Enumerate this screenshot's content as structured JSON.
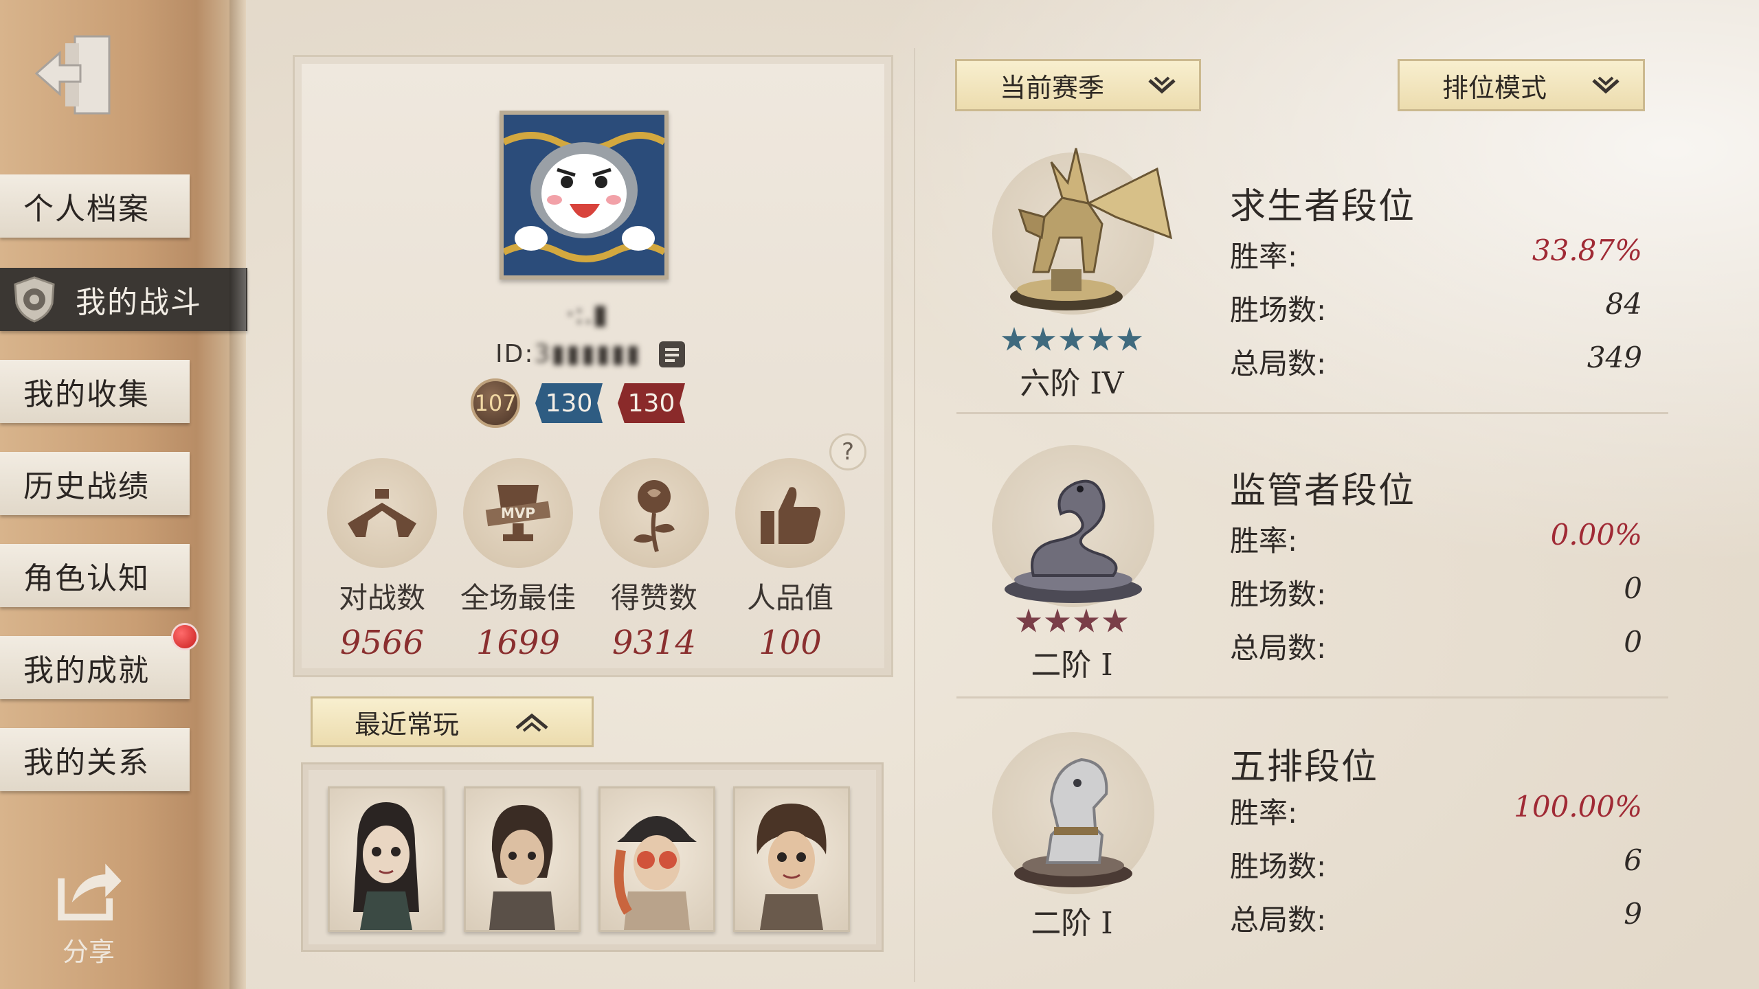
{
  "sidebar": {
    "items": [
      {
        "label": "个人档案",
        "active": false
      },
      {
        "label": "我的战斗",
        "active": true
      },
      {
        "label": "我的收集",
        "active": false
      },
      {
        "label": "历史战绩",
        "active": false
      },
      {
        "label": "角色认知",
        "active": false
      },
      {
        "label": "我的成就",
        "active": false,
        "notification": true
      },
      {
        "label": "我的关系",
        "active": false
      }
    ],
    "share_label": "分享"
  },
  "profile": {
    "name": "·:.▮",
    "id_prefix": "ID:",
    "id_value": "3▮▮▮▮▮▮",
    "level": "107",
    "badge_blue": "130",
    "badge_red": "130",
    "stats": [
      {
        "label": "对战数",
        "value": "9566",
        "icon": "dual-pistols-icon"
      },
      {
        "label": "全场最佳",
        "value": "1699",
        "icon": "mvp-trophy-icon"
      },
      {
        "label": "得赞数",
        "value": "9314",
        "icon": "rose-icon"
      },
      {
        "label": "人品值",
        "value": "100",
        "icon": "thumbs-up-icon"
      }
    ]
  },
  "recent": {
    "button_label": "最近常玩",
    "portraits": [
      "character-1",
      "character-2",
      "character-3",
      "character-4"
    ]
  },
  "filters": {
    "season": "当前赛季",
    "mode": "排位模式"
  },
  "ranks": [
    {
      "title": "求生者段位",
      "tier": "六阶 IV",
      "stars": 5,
      "star_color": "#3f6a7e",
      "emblem": "pegasus-icon",
      "win_rate_label": "胜率:",
      "win_rate": "33.87%",
      "wins_label": "胜场数:",
      "wins": "84",
      "total_label": "总局数:",
      "total": "349"
    },
    {
      "title": "监管者段位",
      "tier": "二阶 I",
      "stars": 4,
      "star_color": "#7a3e48",
      "emblem": "serpent-icon",
      "win_rate_label": "胜率:",
      "win_rate": "0.00%",
      "wins_label": "胜场数:",
      "wins": "0",
      "total_label": "总局数:",
      "total": "0"
    },
    {
      "title": "五排段位",
      "tier": "二阶 I",
      "stars": 0,
      "star_color": "#7a3e48",
      "emblem": "knight-chess-icon",
      "win_rate_label": "胜率:",
      "win_rate": "100.00%",
      "wins_label": "胜场数:",
      "wins": "6",
      "total_label": "总局数:",
      "total": "9"
    }
  ]
}
